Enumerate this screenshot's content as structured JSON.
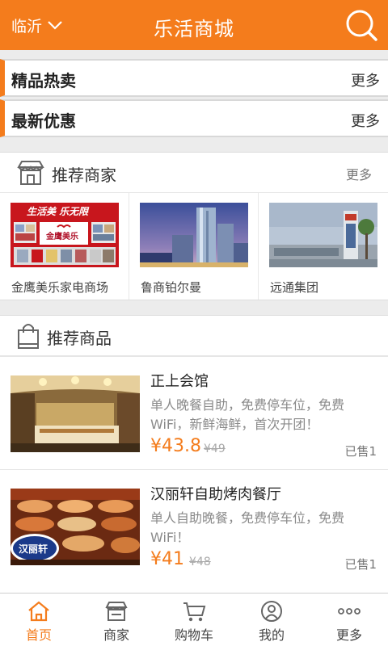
{
  "header": {
    "city": "临沂",
    "title": "乐活商城"
  },
  "bars": [
    {
      "title": "精品热卖",
      "more": "更多"
    },
    {
      "title": "最新优惠",
      "more": "更多"
    }
  ],
  "merchants_section": {
    "title": "推荐商家",
    "more": "更多",
    "items": [
      {
        "name": "金鹰美乐家电商场",
        "banner_text": "生活美 乐无限",
        "logo_text": "金鹰美乐"
      },
      {
        "name": "鲁商铂尔曼"
      },
      {
        "name": "远通集团"
      }
    ]
  },
  "products_section": {
    "title": "推荐商品",
    "items": [
      {
        "name": "正上会馆",
        "desc": "单人晚餐自助，免费停车位，免费WiFi，新鲜海鲜，首次开团！",
        "price": "¥43.8",
        "old_price": "¥49",
        "sold": "已售1"
      },
      {
        "name": "汉丽轩自助烤肉餐厅",
        "desc": "单人自助晚餐，免费停车位，免费WiFi！",
        "price": "¥41",
        "old_price": "¥48",
        "sold": "已售1",
        "logo_text": "汉丽轩"
      }
    ]
  },
  "tabbar": {
    "items": [
      {
        "label": "首页",
        "icon": "home-icon",
        "active": true
      },
      {
        "label": "商家",
        "icon": "shop-icon",
        "active": false
      },
      {
        "label": "购物车",
        "icon": "cart-icon",
        "active": false
      },
      {
        "label": "我的",
        "icon": "user-icon",
        "active": false
      },
      {
        "label": "更多",
        "icon": "more-dots-icon",
        "active": false
      }
    ]
  },
  "colors": {
    "accent": "#f47c1c",
    "background": "#ececec"
  }
}
